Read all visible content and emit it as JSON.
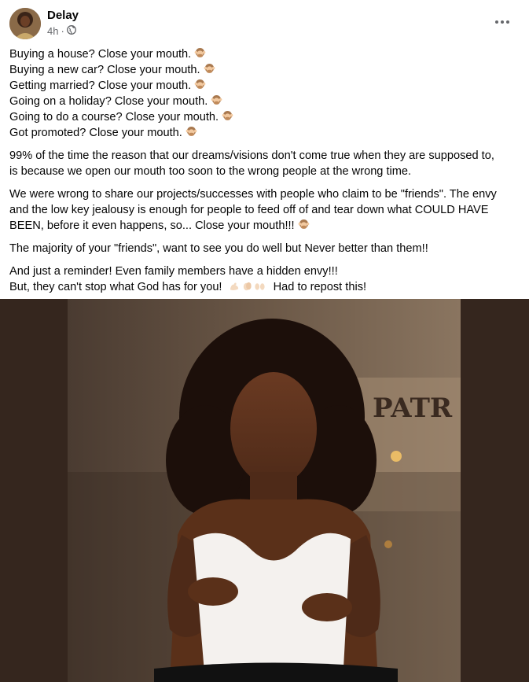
{
  "post": {
    "author": "Delay",
    "time": "4h",
    "lines": [
      "Buying a house?  Close your mouth.",
      "Buying a new car?  Close your mouth.",
      "Getting married?  Close your mouth.",
      "Going on a holiday?  Close your mouth.",
      "Going to do a course?  Close your mouth.",
      "Got promoted?  Close your mouth."
    ],
    "para1_line1": "99% of the time the reason that our dreams/visions don't come true when they are supposed to,",
    "para1_line2": "is because we open our mouth too soon to the wrong people at the wrong time.",
    "para2_line1": "We were wrong to share our projects/successes with people who claim to be \"friends\".  The envy",
    "para2_line2": "and the low key jealousy is enough for people to feed off of and tear down what COULD HAVE",
    "para2_line3": "BEEN, before it even happens, so... Close your mouth!!!",
    "para3": "The majority of your \"friends\", want to see you do well but Never better than them!!",
    "para4_line1": "And just a reminder!  Even family members have a hidden envy!!!",
    "para4_line2a": "But, they can't stop what God has for you!",
    "para4_line2b": "Had to repost this!",
    "photo_sign": "PATR"
  },
  "colors": {
    "text": "#050505",
    "meta": "#65676b",
    "photo_bg": "#35261e"
  },
  "icons": [
    "globe-icon",
    "more-options-icon",
    "speak-no-evil-monkey-icon",
    "flexed-biceps-icon",
    "clapping-hands-icon",
    "raising-hands-icon"
  ]
}
